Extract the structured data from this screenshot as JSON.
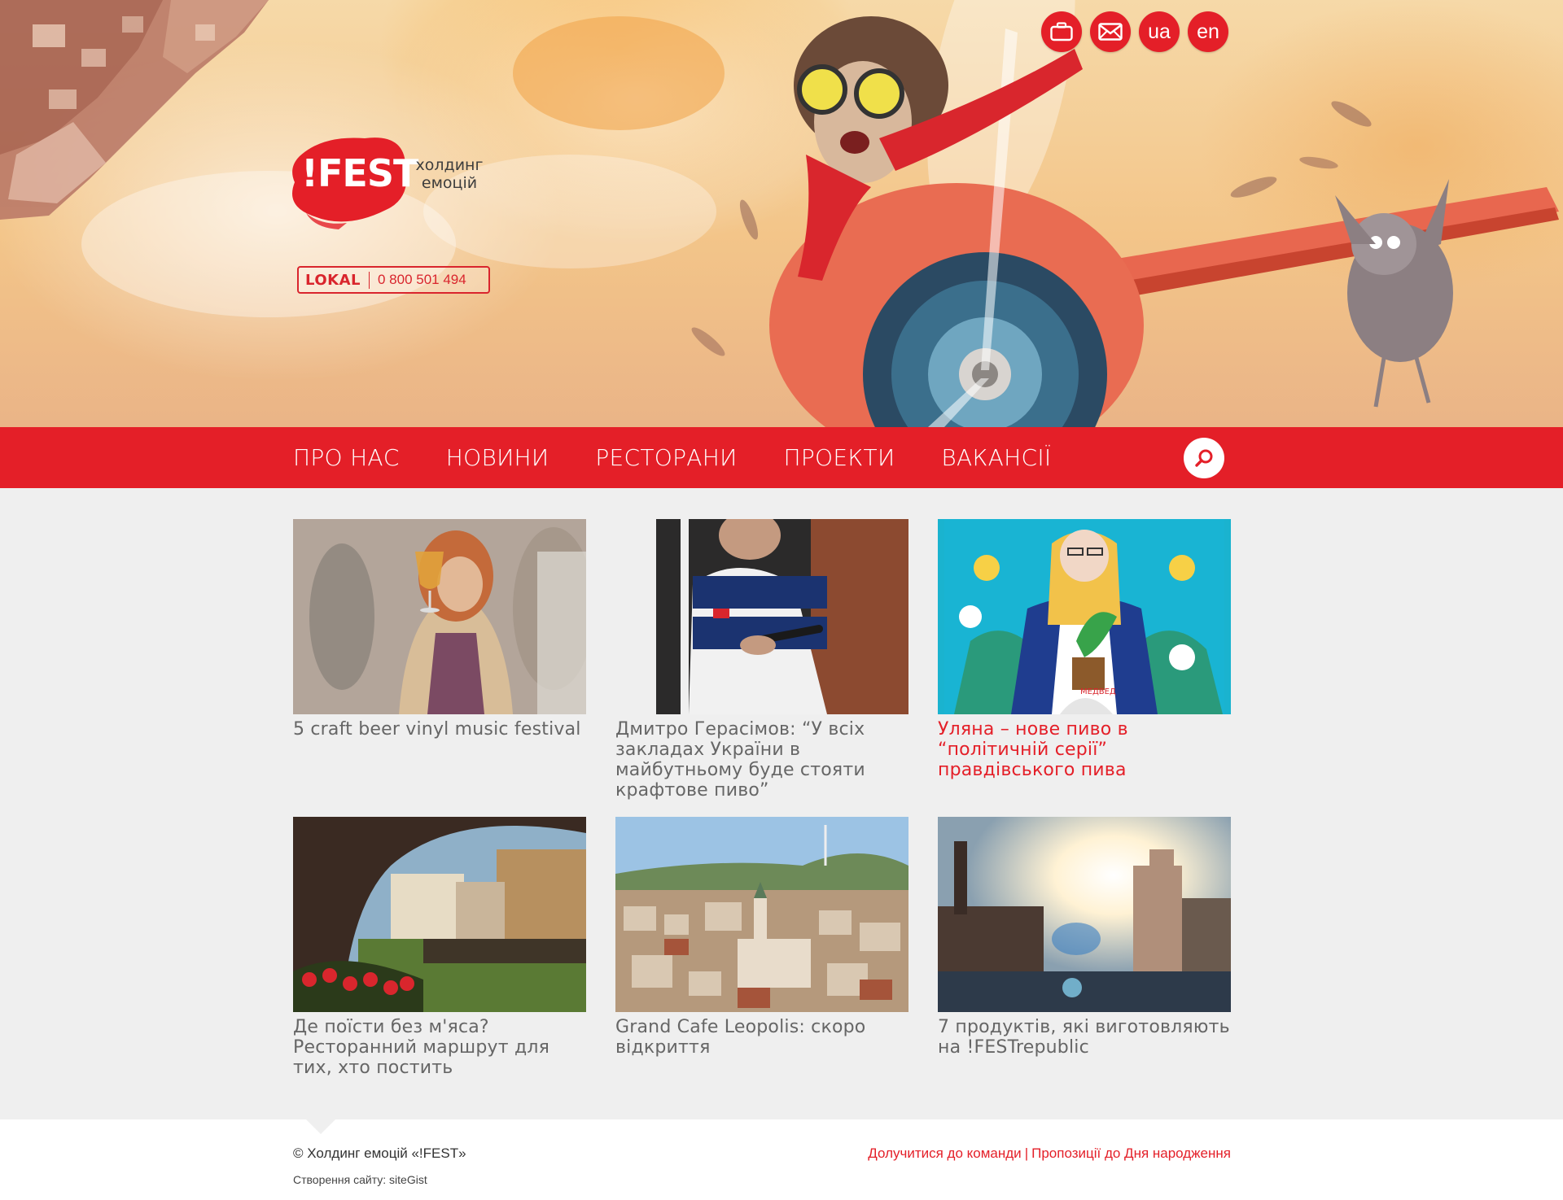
{
  "brand": {
    "logo_text": "!FEST",
    "tagline_line1": "холдинг",
    "tagline_line2": "емоцій",
    "lokal_label": "LOKAL",
    "lokal_phone": "0 800 501 494"
  },
  "top_icons": [
    {
      "icon": "briefcase-icon",
      "label": ""
    },
    {
      "icon": "envelope-icon",
      "label": ""
    },
    {
      "icon": "lang-ua",
      "label": "ua"
    },
    {
      "icon": "lang-en",
      "label": "en"
    }
  ],
  "nav": {
    "items": [
      "ПРО НАС",
      "НОВИНИ",
      "РЕСТОРАНИ",
      "ПРОЕКТИ",
      "ВАКАНСІЇ"
    ],
    "search_icon": "search-icon"
  },
  "articles": [
    {
      "title": "5 craft beer vinyl music festival",
      "active": false
    },
    {
      "title": "Дмитро Герасімов: “У всіх закладах України в майбутньому буде стояти крафтове пиво”",
      "active": false
    },
    {
      "title": "Уляна – нове пиво в “політичній серії” правдівського пива",
      "active": true
    },
    {
      "title": "Де поїсти без м'яса? Ресторанний маршрут для тих, хто постить",
      "active": false
    },
    {
      "title": "Grand Cafe Leopolis: скоро відкриття",
      "active": false
    },
    {
      "title": "7 продуктів, які виготовляють на !FESTrepublic",
      "active": false
    }
  ],
  "footer": {
    "copyright": "© Холдинг емоцій «!FEST»",
    "made_by": "Створення сайту: siteGist",
    "link_join": "Долучитися до команди",
    "separator": "|",
    "link_birthday": "Пропозиції до Дня народження"
  },
  "colors": {
    "accent": "#e41f28",
    "background": "#efefef",
    "text_muted": "#666666"
  }
}
